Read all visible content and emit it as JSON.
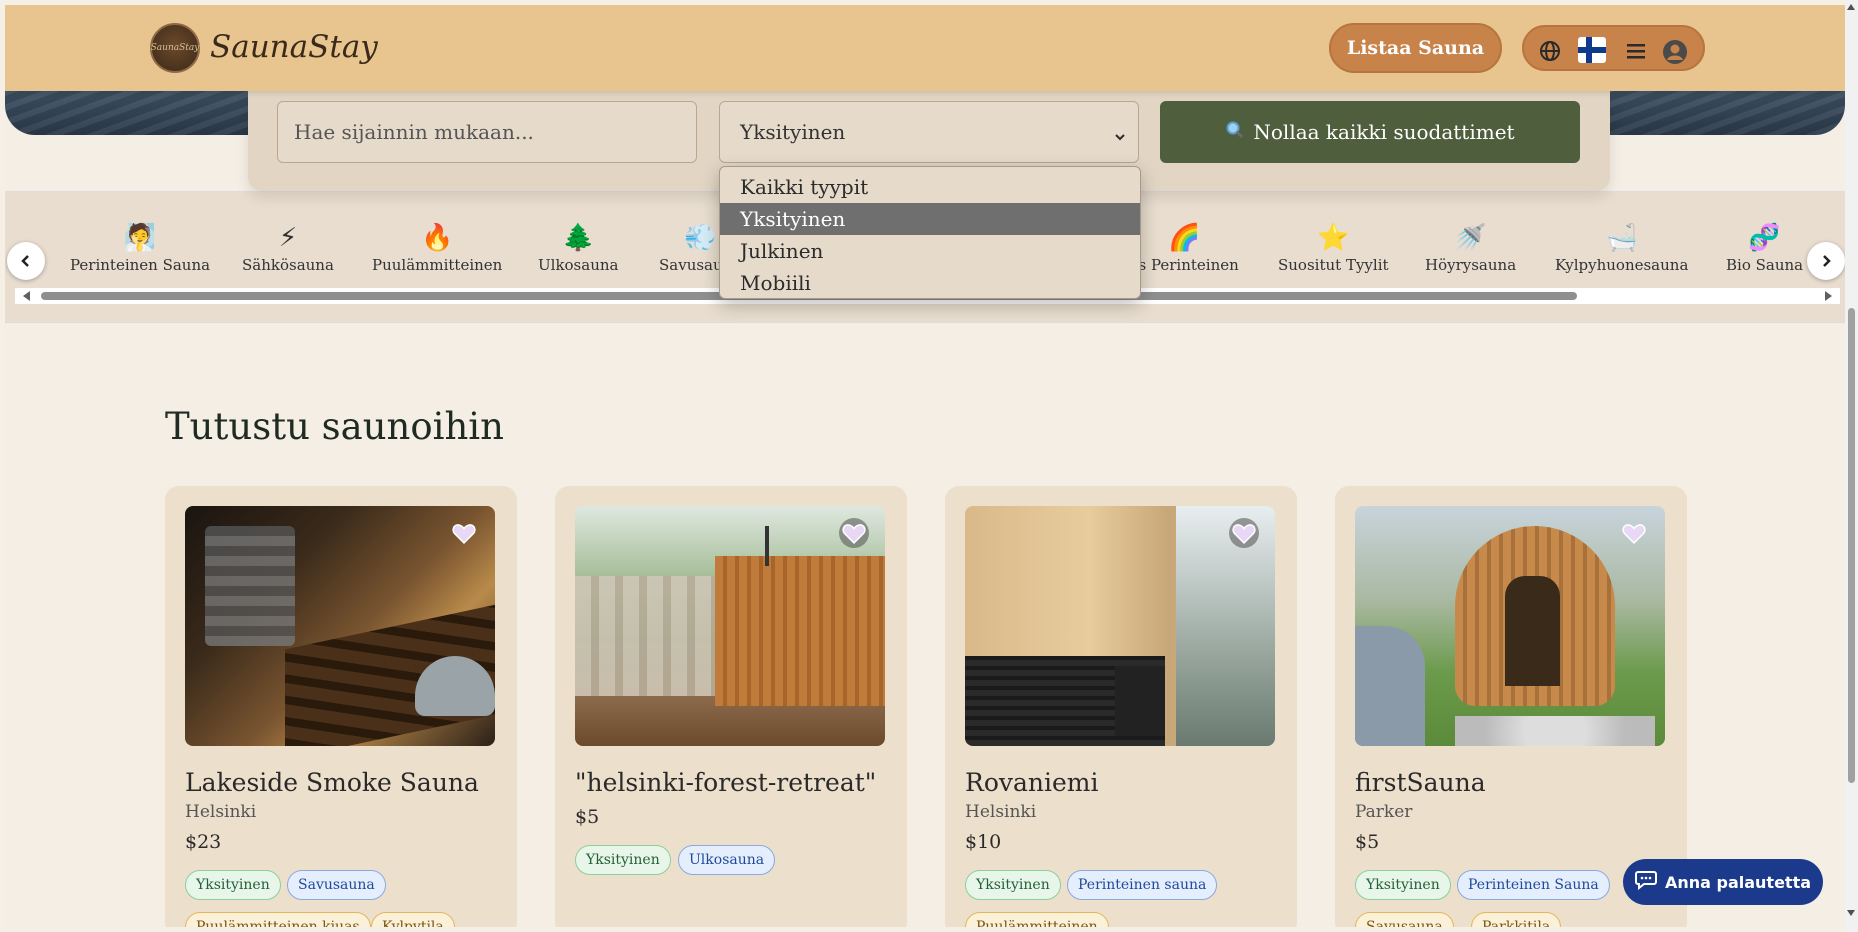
{
  "header": {
    "brand": "SaunaStay",
    "logo_text": "SaunaStay",
    "list_button": "Listaa Sauna",
    "icons": [
      "globe-icon",
      "finland-flag-icon",
      "menu-icon",
      "user-icon"
    ]
  },
  "search": {
    "location_placeholder": "Hae sijainnin mukaan...",
    "type_selected": "Yksityinen",
    "reset_label": "Nollaa kaikki suodattimet"
  },
  "type_dropdown": {
    "options": [
      "Kaikki tyypit",
      "Yksityinen",
      "Julkinen",
      "Mobiili"
    ],
    "selected_index": 1
  },
  "categories": [
    {
      "label": "Perinteinen Sauna",
      "icon": "🧖"
    },
    {
      "label": "Sähkösauna",
      "icon": "⚡"
    },
    {
      "label": "Puulämmitteinen",
      "icon": "🔥"
    },
    {
      "label": "Ulkosauna",
      "icon": "🌲"
    },
    {
      "label": "Savusauna",
      "icon": "💨"
    },
    {
      "label": "vs Perinteinen",
      "icon": "🌈"
    },
    {
      "label": "Suositut Tyylit",
      "icon": "⭐"
    },
    {
      "label": "Höyrysauna",
      "icon": "🚿"
    },
    {
      "label": "Kylpyhuonesauna",
      "icon": "🛁"
    },
    {
      "label": "Bio Sauna",
      "icon": "🧬"
    }
  ],
  "section": {
    "title": "Tutustu saunoihin"
  },
  "cards": [
    {
      "title": "Lakeside Smoke Sauna",
      "location": "Helsinki",
      "price": "$23",
      "tags": [
        "Yksityinen",
        "Savusauna"
      ],
      "tags2": [
        "Puulämmitteinen kiuas",
        "Kylpytila"
      ]
    },
    {
      "title": "\"helsinki-forest-retreat\"",
      "location": "",
      "price": "$5",
      "tags": [
        "Yksityinen",
        "Ulkosauna"
      ],
      "tags2": []
    },
    {
      "title": "Rovaniemi",
      "location": "Helsinki",
      "price": "$10",
      "tags": [
        "Yksityinen",
        "Perinteinen sauna"
      ],
      "tags2": [
        "Puulämmitteinen"
      ]
    },
    {
      "title": "firstSauna",
      "location": "Parker",
      "price": "$5",
      "tags": [
        "Yksityinen",
        "Perinteinen Sauna"
      ],
      "tags2": [
        "Savusauna",
        "Parkkitila"
      ]
    }
  ],
  "feedback": {
    "label": "Anna palautetta"
  },
  "colors": {
    "header": "#e8c48e",
    "accent": "#c8834a",
    "reset_button": "#4f5e3d",
    "feedback_button": "#1b3a8c"
  }
}
